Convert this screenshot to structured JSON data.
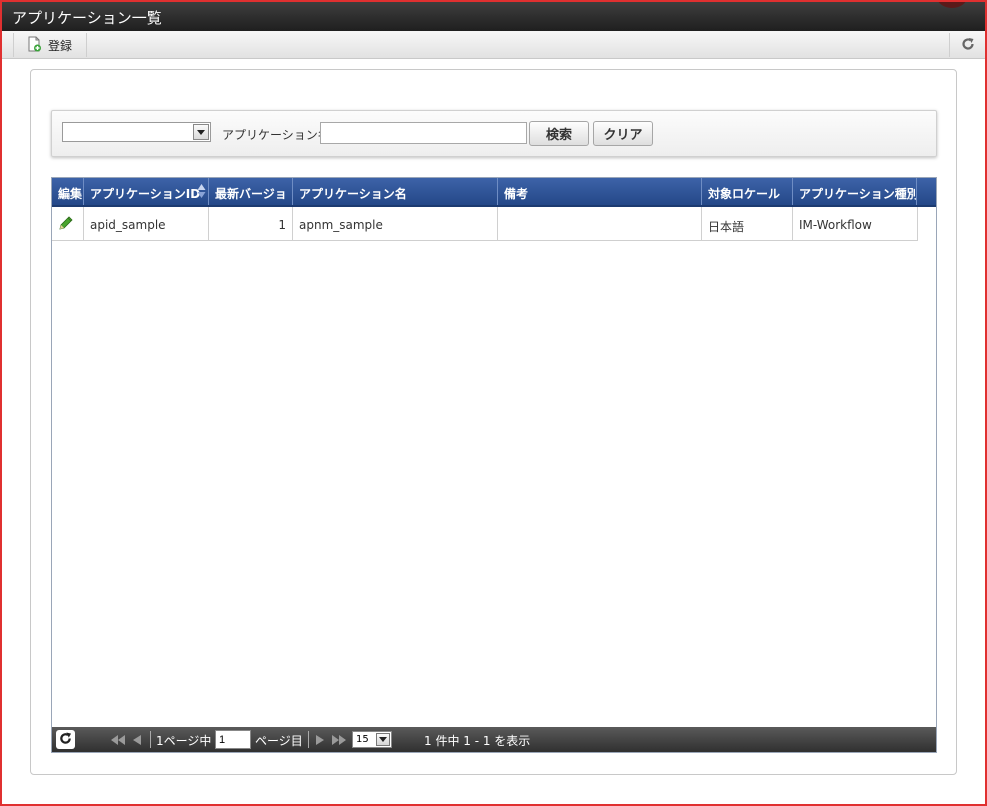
{
  "window": {
    "title": "アプリケーション一覧"
  },
  "toolbar": {
    "register_label": "登録"
  },
  "search": {
    "select_value": "",
    "name_label": "アプリケーション名",
    "name_value": "",
    "search_button": "検索",
    "clear_button": "クリア"
  },
  "grid": {
    "columns": [
      {
        "label": "編集"
      },
      {
        "label": "アプリケーションID"
      },
      {
        "label": "最新バージョ"
      },
      {
        "label": "アプリケーション名"
      },
      {
        "label": "備考"
      },
      {
        "label": "対象ロケール"
      },
      {
        "label": "アプリケーション種別"
      }
    ],
    "rows": [
      {
        "application_id": "apid_sample",
        "version": "1",
        "application_name": "apnm_sample",
        "remarks": "",
        "locale": "日本語",
        "type": "IM-Workflow"
      }
    ]
  },
  "pager": {
    "page_prefix": "1ページ中",
    "page_value": "1",
    "page_suffix": "ページ目",
    "per_page": "15",
    "summary": "1 件中 1 - 1 を表示"
  },
  "colors": {
    "header_blue": "#2d52a0",
    "pager_dark": "#3a3a3a",
    "frame_red": "#e03030"
  }
}
